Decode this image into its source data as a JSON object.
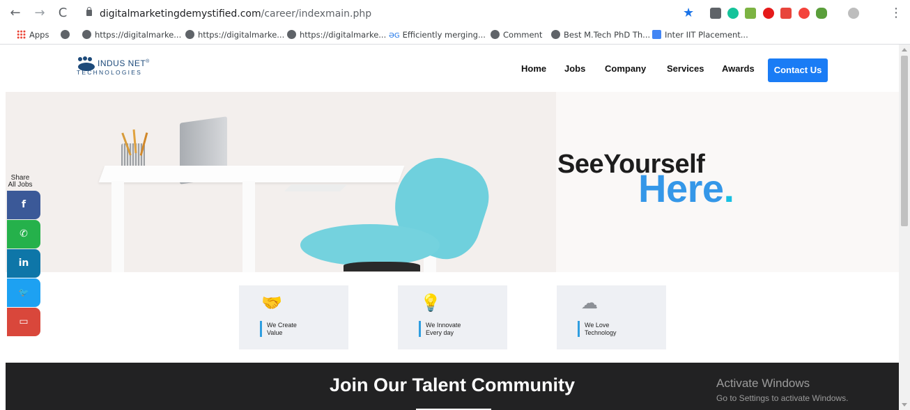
{
  "browser": {
    "url_domain": "digitalmarketingdemystified.com",
    "url_path": "/career/indexmain.php",
    "nav_icons": {
      "back": "back-arrow-icon",
      "forward": "forward-arrow-icon",
      "reload": "reload-icon"
    },
    "bookmarks": [
      {
        "label": "Apps",
        "icon": "apps-grid-icon"
      },
      {
        "label": "",
        "icon": "globe-icon"
      },
      {
        "label": "https://digitalmarke...",
        "icon": "globe-icon"
      },
      {
        "label": "https://digitalmarke...",
        "icon": "globe-icon"
      },
      {
        "label": "https://digitalmarke...",
        "icon": "globe-icon"
      },
      {
        "label": "Efficiently merging...",
        "icon": "dg-icon"
      },
      {
        "label": "Comment",
        "icon": "globe-icon"
      },
      {
        "label": "Best M.Tech PhD Th...",
        "icon": "globe-icon"
      },
      {
        "label": "Inter IIT Placement...",
        "icon": "doc-icon"
      }
    ]
  },
  "logo": {
    "name": "INDUS NET",
    "registered": "®",
    "sub": "TECHNOLOGIES"
  },
  "nav": {
    "items": [
      "Home",
      "Jobs",
      "Company",
      "Services",
      "Awards"
    ],
    "contact": "Contact Us"
  },
  "hero": {
    "line1": "SeeYourself",
    "line2": "Here",
    "dot": "."
  },
  "cards": [
    {
      "line1": "We Create",
      "line2": "Value",
      "icon": "handshake-icon"
    },
    {
      "line1": "We Innovate",
      "line2": "Every day",
      "icon": "idea-head-icon"
    },
    {
      "line1": "We Love",
      "line2": "Technology",
      "icon": "tech-tree-icon"
    }
  ],
  "share": {
    "label_line1": "Share",
    "label_line2": "All Jobs",
    "buttons": [
      {
        "name": "facebook",
        "glyph": "f",
        "color": "#3b5998"
      },
      {
        "name": "whatsapp",
        "glyph": "✆",
        "color": "#25b14b"
      },
      {
        "name": "linkedin",
        "glyph": "in",
        "color": "#0e76a8"
      },
      {
        "name": "twitter",
        "glyph": "🐦",
        "color": "#1da1f2"
      },
      {
        "name": "email",
        "glyph": "▭",
        "color": "#d9473b"
      }
    ]
  },
  "talent": {
    "title": "Join Our Talent Community"
  },
  "windows": {
    "line1": "Activate Windows",
    "line2": "Go to Settings to activate Windows."
  },
  "colors": {
    "accent": "#1a7cf5",
    "hero_blue": "#3497e8",
    "dark_band": "#222223"
  }
}
